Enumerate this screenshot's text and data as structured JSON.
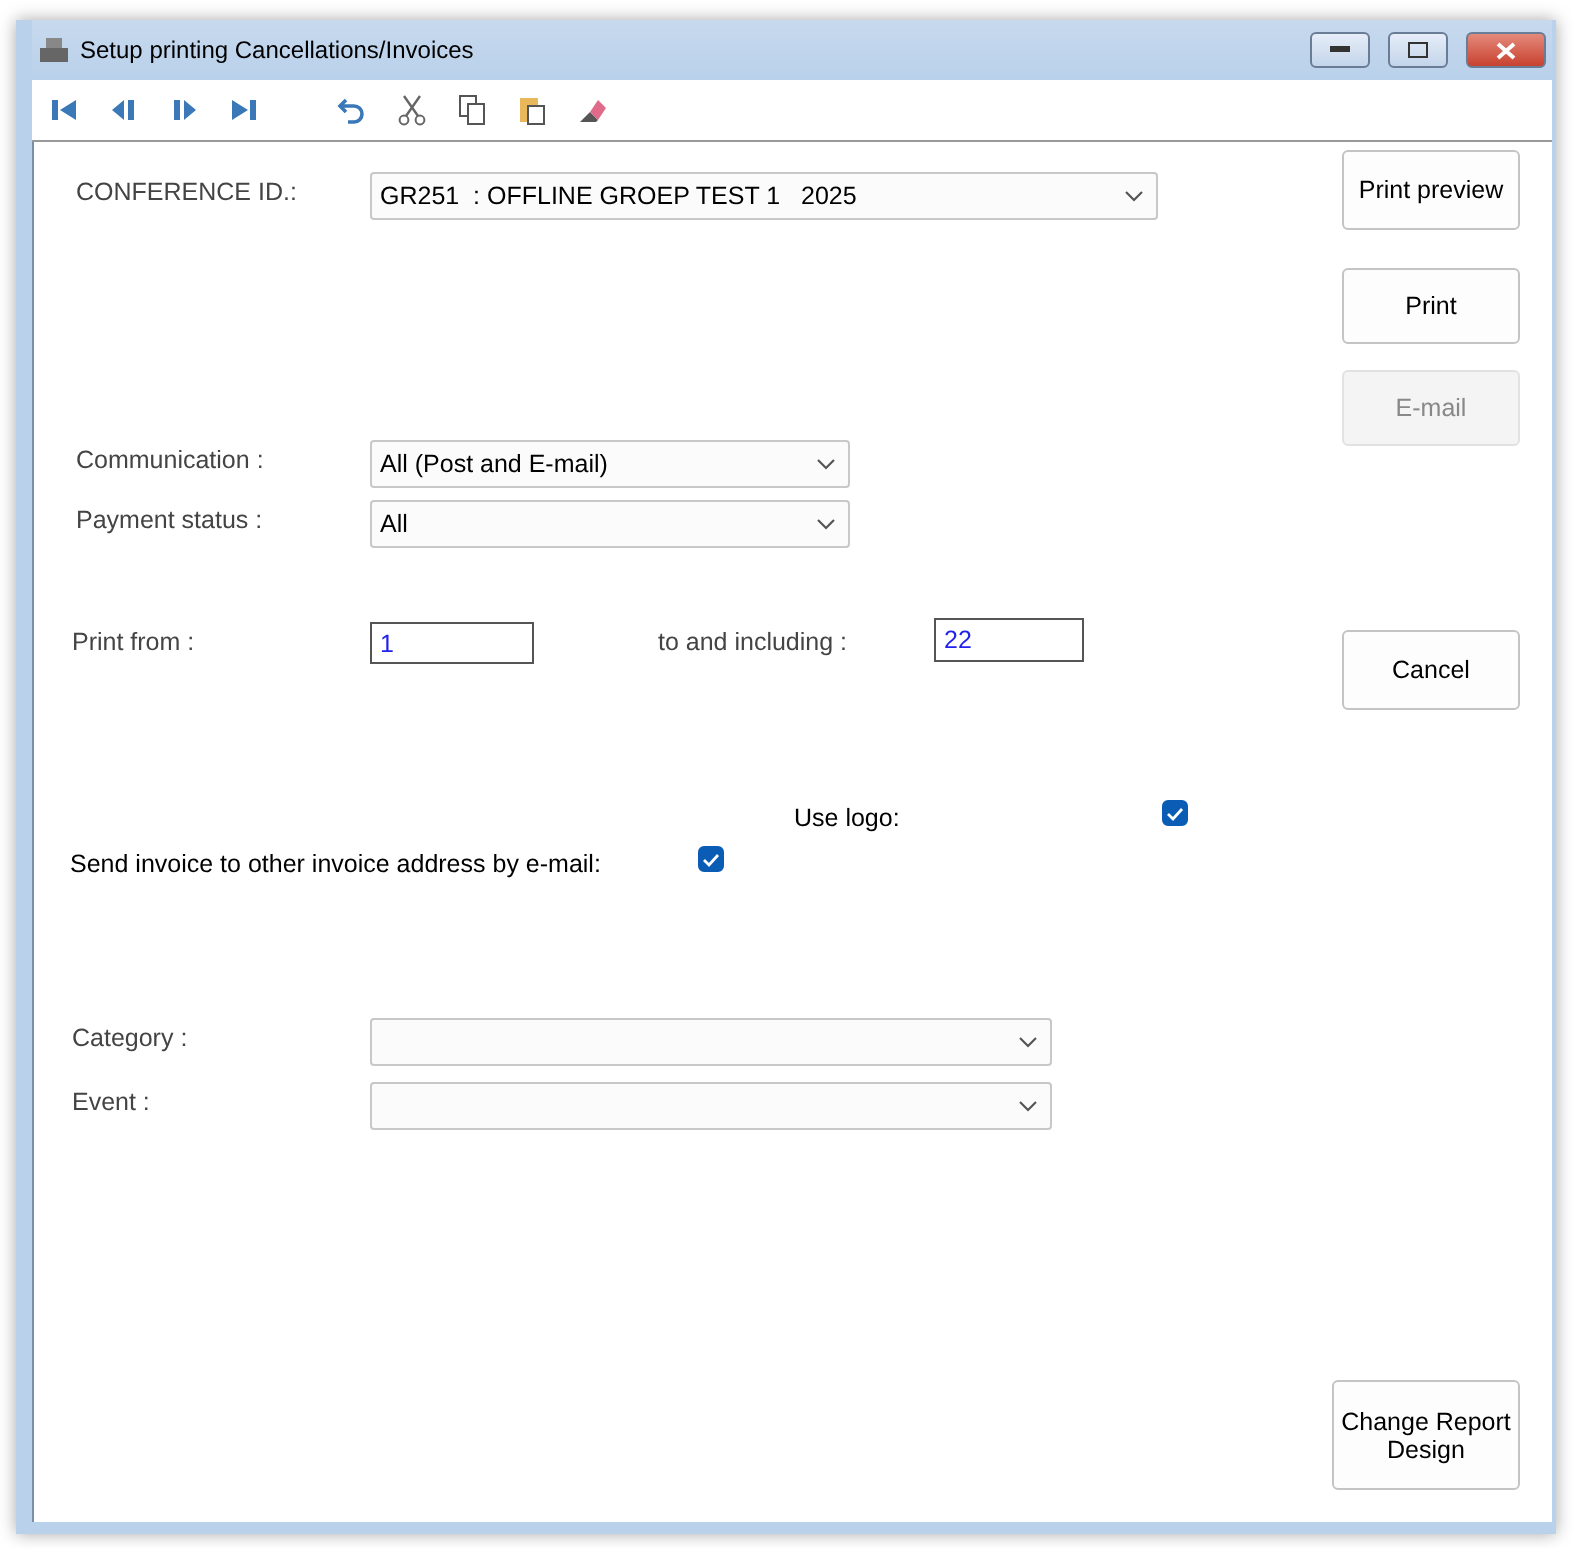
{
  "window": {
    "title": "Setup printing Cancellations/Invoices"
  },
  "conference": {
    "label": "CONFERENCE ID.:",
    "value": "GR251  : OFFLINE GROEP TEST 1   2025"
  },
  "communication": {
    "label": "Communication :",
    "value": "All (Post and E-mail)"
  },
  "payment_status": {
    "label": "Payment status :",
    "value": "All"
  },
  "print_from": {
    "label": "Print from :",
    "value": "1"
  },
  "print_to": {
    "label": "to and including :",
    "value": "22"
  },
  "use_logo": {
    "label": "Use logo:",
    "checked": true
  },
  "send_other_address": {
    "label": "Send invoice to other invoice address by e-mail:",
    "checked": true
  },
  "category": {
    "label": "Category :"
  },
  "event": {
    "label": "Event :"
  },
  "buttons": [
    {
      "label": "Print preview",
      "disabled": false
    },
    {
      "label": "Print",
      "disabled": false
    },
    {
      "label": "E-mail",
      "disabled": true
    },
    {
      "label": "Cancel",
      "disabled": false
    }
  ],
  "design_button": {
    "label": "Change Report Design"
  }
}
